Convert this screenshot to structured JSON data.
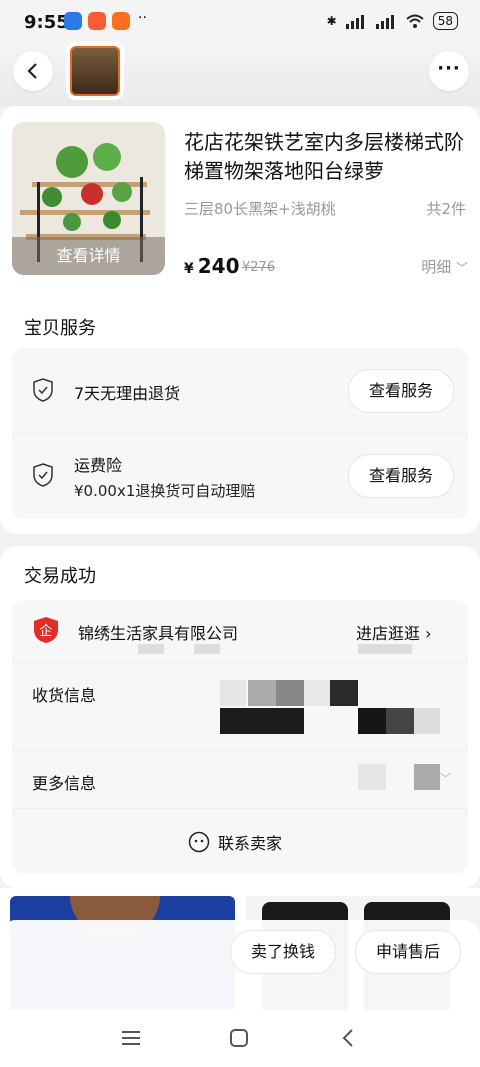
{
  "status": {
    "time": "9:55",
    "battery": "58"
  },
  "product": {
    "title": "花店花架铁艺室内多层楼梯式阶梯置物架落地阳台绿萝",
    "spec": "三层80长黑架+浅胡桃",
    "count": "共2件",
    "price_symbol": "¥",
    "price": "240",
    "original_price": "¥276",
    "detail_link": "明细",
    "view_detail": "查看详情"
  },
  "service": {
    "title": "宝贝服务",
    "items": [
      {
        "name": "7天无理由退货",
        "desc": "",
        "button": "查看服务"
      },
      {
        "name": "运费险",
        "desc": "¥0.00x1退换货可自动理赔",
        "button": "查看服务"
      }
    ]
  },
  "deal": {
    "title": "交易成功",
    "shop_name": "锦绣生活家具有限公司",
    "shop_link": "进店逛逛",
    "shipping_label": "收货信息",
    "more_label": "更多信息",
    "contact": "联系卖家"
  },
  "actions": {
    "sell": "卖了换钱",
    "aftersale": "申请售后"
  },
  "colors": {
    "shop_red": "#e02e24",
    "accent_orange": "#e46b2c"
  }
}
